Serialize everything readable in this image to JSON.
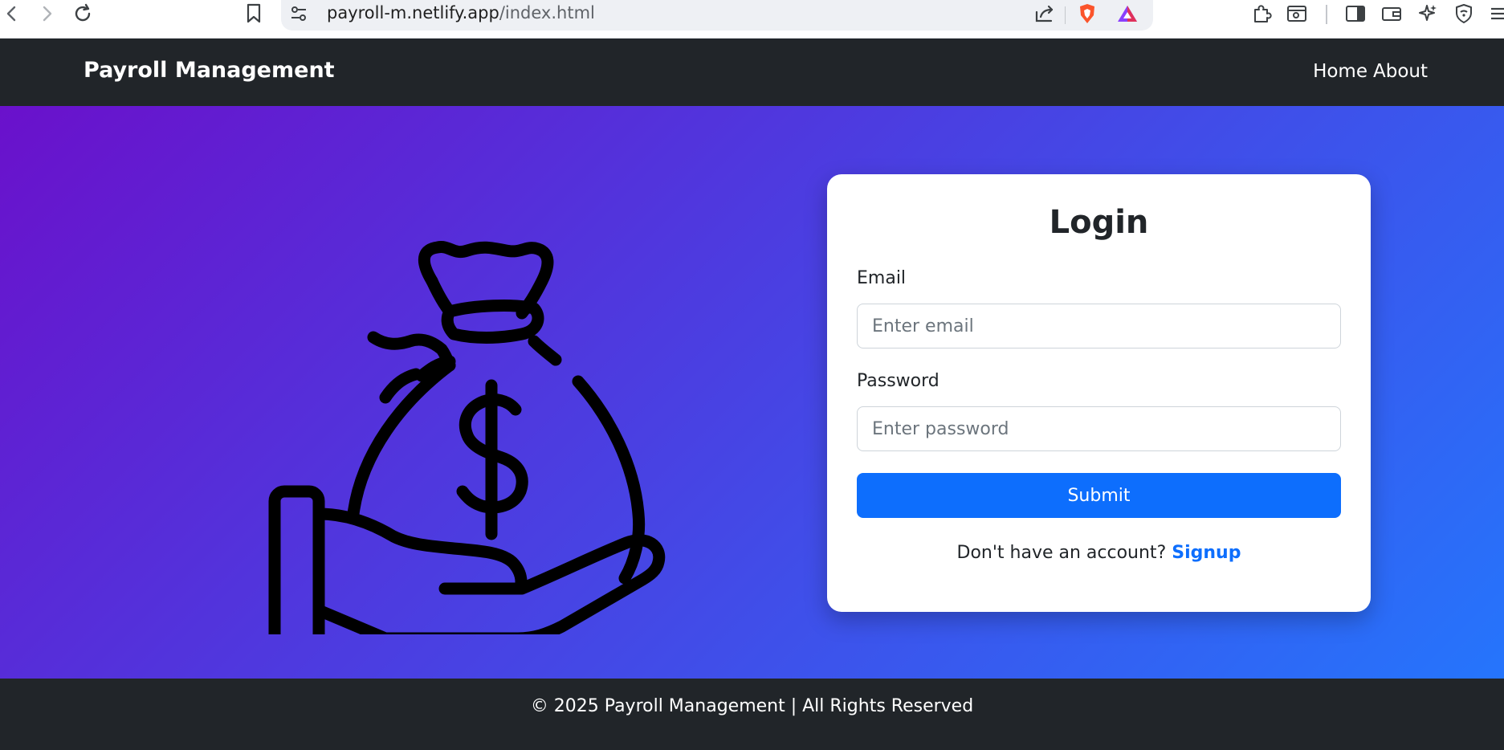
{
  "browser": {
    "url_host": "payroll-m.netlify.app",
    "url_path": "/index.html",
    "icons": [
      "back-icon",
      "forward-icon",
      "reload-icon",
      "bookmark-icon",
      "site-settings-icon",
      "share-icon",
      "brave-shield-icon",
      "brave-rewards-icon",
      "extensions-icon",
      "screenshot-icon",
      "sidebar-icon",
      "wallet-icon",
      "leo-ai-icon",
      "vpn-icon",
      "menu-icon"
    ]
  },
  "navbar": {
    "brand": "Payroll Management",
    "links": [
      {
        "label": "Home"
      },
      {
        "label": "About"
      }
    ]
  },
  "hero": {
    "illustration_icon": "money-bag-in-hand-icon",
    "gradient": [
      "#6a11cb",
      "#2575fc"
    ]
  },
  "login": {
    "title": "Login",
    "email_label": "Email",
    "email_placeholder": "Enter email",
    "email_value": "",
    "password_label": "Password",
    "password_placeholder": "Enter password",
    "password_value": "",
    "submit_label": "Submit",
    "signup_prompt": "Don't have an account?",
    "signup_link": "Signup"
  },
  "footer": {
    "text": "© 2025 Payroll Management | All Rights Reserved"
  },
  "colors": {
    "navbar_bg": "#212529",
    "primary": "#0d6efd",
    "card_bg": "#ffffff"
  }
}
